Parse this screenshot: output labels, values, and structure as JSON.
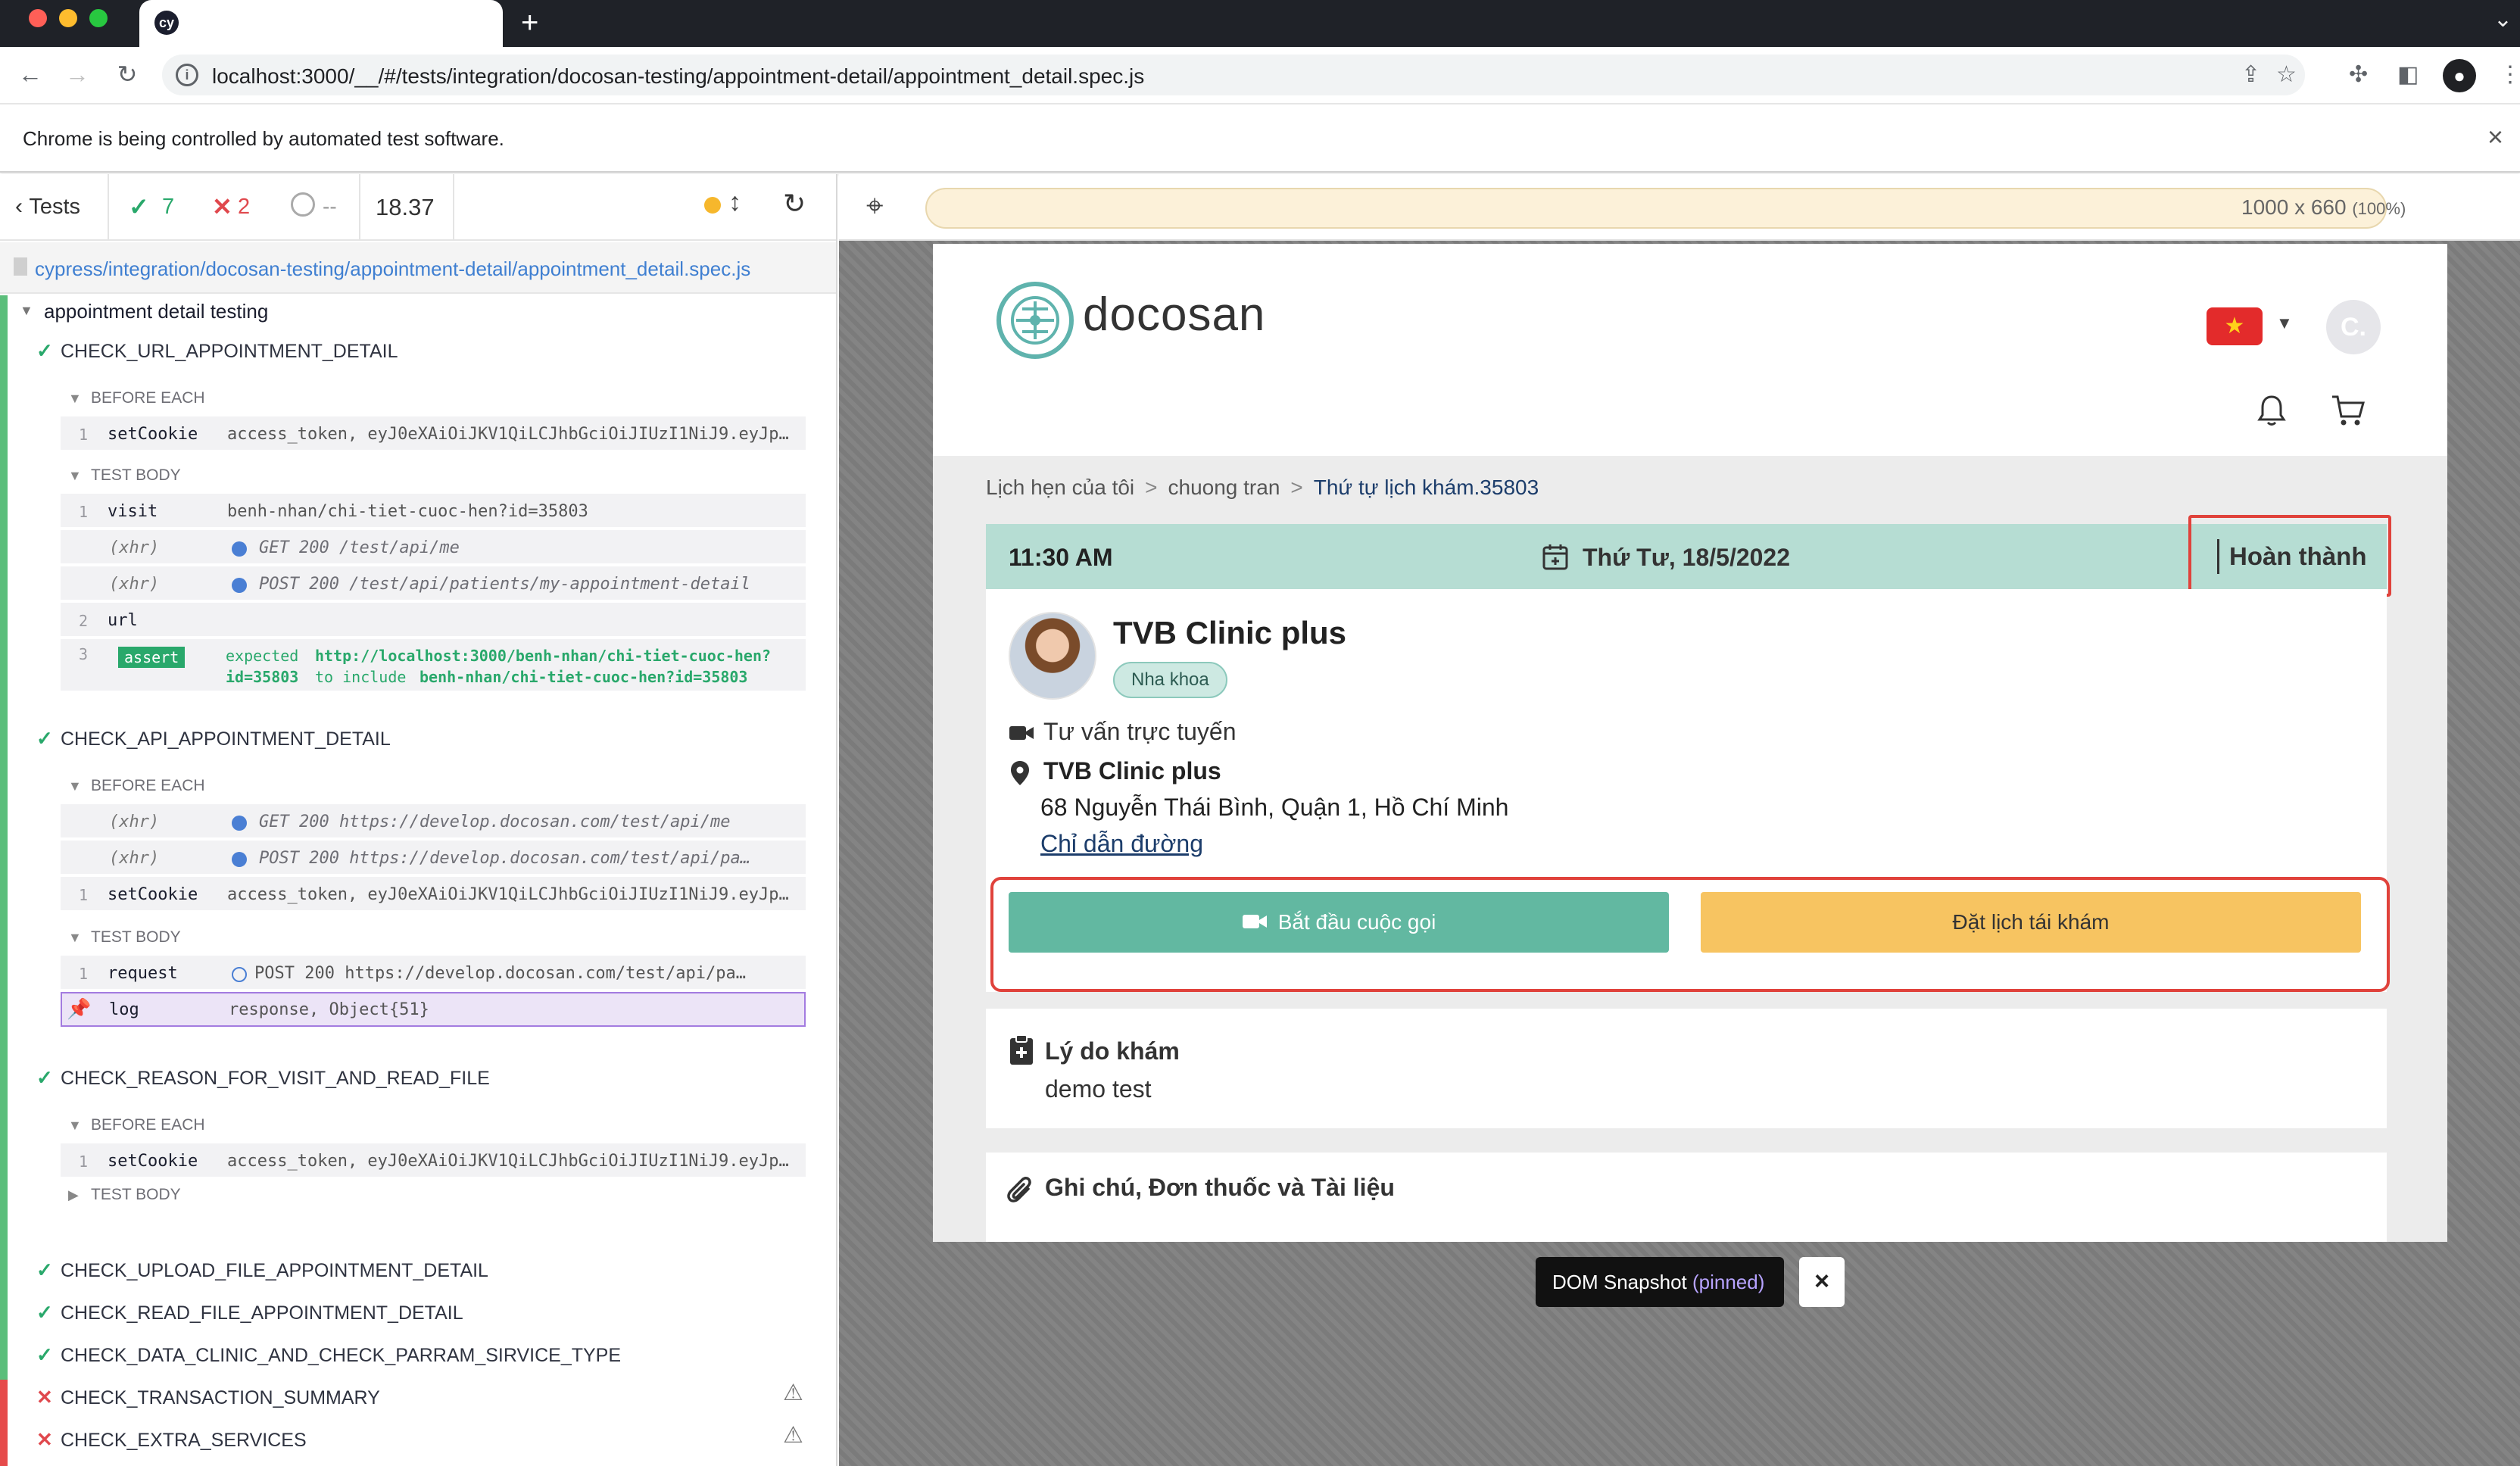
{
  "browser": {
    "tab_favicon": "cy",
    "new_tab": "+",
    "url": "localhost:3000/__/#/tests/integration/docosan-testing/appointment-detail/appointment_detail.spec.js",
    "infobar_text": "Chrome is being controlled by automated test software.",
    "infobar_close": "×"
  },
  "reporter": {
    "tests_label": "Tests",
    "passed": "7",
    "failed": "2",
    "pending": "--",
    "duration": "18.37",
    "spec_path": "cypress/integration/docosan-testing/appointment-detail/appointment_detail.spec.js",
    "suite": "appointment detail testing",
    "tests": [
      {
        "title": "CHECK_URL_APPOINTMENT_DETAIL"
      },
      {
        "title": "CHECK_API_APPOINTMENT_DETAIL"
      },
      {
        "title": "CHECK_REASON_FOR_VISIT_AND_READ_FILE"
      },
      {
        "title": "CHECK_UPLOAD_FILE_APPOINTMENT_DETAIL"
      },
      {
        "title": "CHECK_READ_FILE_APPOINTMENT_DETAIL"
      },
      {
        "title": "CHECK_DATA_CLINIC_AND_CHECK_PARRAM_SIRVICE_TYPE"
      },
      {
        "title": "CHECK_TRANSACTION_SUMMARY"
      },
      {
        "title": "CHECK_EXTRA_SERVICES"
      }
    ],
    "hooks": {
      "before_each": "BEFORE EACH",
      "test_body": "TEST BODY"
    },
    "t1": {
      "c1": {
        "num": "1",
        "name": "setCookie",
        "msg": "access_token, eyJ0eXAiOiJKV1QiLCJhbGciOiJIUzI1NiJ9.eyJpc3MiO…"
      },
      "c2": {
        "num": "1",
        "name": "visit",
        "msg": "benh-nhan/chi-tiet-cuoc-hen?id=35803"
      },
      "c3": {
        "name": "(xhr)",
        "msg": "GET 200 /test/api/me"
      },
      "c4": {
        "name": "(xhr)",
        "msg": "POST 200 /test/api/patients/my-appointment-detail"
      },
      "c5": {
        "num": "2",
        "name": "url"
      },
      "c6": {
        "num": "3",
        "badge": "assert",
        "expected": "expected",
        "url": "http://localhost:3000/benh-nhan/chi-tiet-cuoc-hen?",
        "url2": "id=35803",
        "to_include": "to include",
        "include_val": "benh-nhan/chi-tiet-cuoc-hen?id=35803"
      }
    },
    "t2": {
      "c1": {
        "name": "(xhr)",
        "msg": "GET 200 https://develop.docosan.com/test/api/me"
      },
      "c2": {
        "name": "(xhr)",
        "msg": "POST 200 https://develop.docosan.com/test/api/pa…"
      },
      "c3": {
        "num": "1",
        "name": "setCookie",
        "msg": "access_token, eyJ0eXAiOiJKV1QiLCJhbGciOiJIUzI1NiJ9.eyJpc3MiO…"
      },
      "c4": {
        "num": "1",
        "name": "request",
        "msg": "POST 200 https://develop.docosan.com/test/api/pa…"
      },
      "c5": {
        "name": "log",
        "msg": "response, Object{51}"
      }
    },
    "t3": {
      "c1": {
        "num": "1",
        "name": "setCookie",
        "msg": "access_token, eyJ0eXAiOiJKV1QiLCJhbGciOiJIUzI1NiJ9.eyJpc3MiO…"
      }
    }
  },
  "aut": {
    "viewport": "1000 x 660",
    "viewport_scale": "(100%)"
  },
  "app": {
    "logo": "docosan",
    "avatar_initial": "C.",
    "breadcrumb": [
      "Lịch hẹn của tôi",
      "chuong tran",
      "Thứ tự lịch khám.35803"
    ],
    "breadcrumb_sep": ">",
    "appointment": {
      "time": "11:30 AM",
      "date": "Thứ Tư, 18/5/2022",
      "status": "Hoàn thành"
    },
    "clinic": {
      "name": "TVB Clinic plus",
      "specialty": "Nha khoa",
      "consult_type": "Tư vấn trực tuyến",
      "location_name": "TVB Clinic plus",
      "address": "68 Nguyễn Thái Bình, Quận 1, Hồ Chí Minh",
      "directions": "Chỉ dẫn đường"
    },
    "buttons": {
      "call": "Bắt đầu cuộc gọi",
      "rebook": "Đặt lịch tái khám"
    },
    "reason": {
      "title": "Lý do khám",
      "text": "demo test"
    },
    "notes": {
      "title": "Ghi chú, Đơn thuốc và Tài liệu"
    }
  },
  "snapshot": {
    "label": "DOM Snapshot",
    "pinned": "(pinned)",
    "close": "×"
  },
  "colors": {
    "accent_teal": "#62b8a1",
    "status_bar": "#b6ddd3",
    "rebook_yellow": "#f7c461",
    "highlight_red": "#e0423b",
    "pass_green": "#29a86b",
    "fail_red": "#e0484d"
  }
}
